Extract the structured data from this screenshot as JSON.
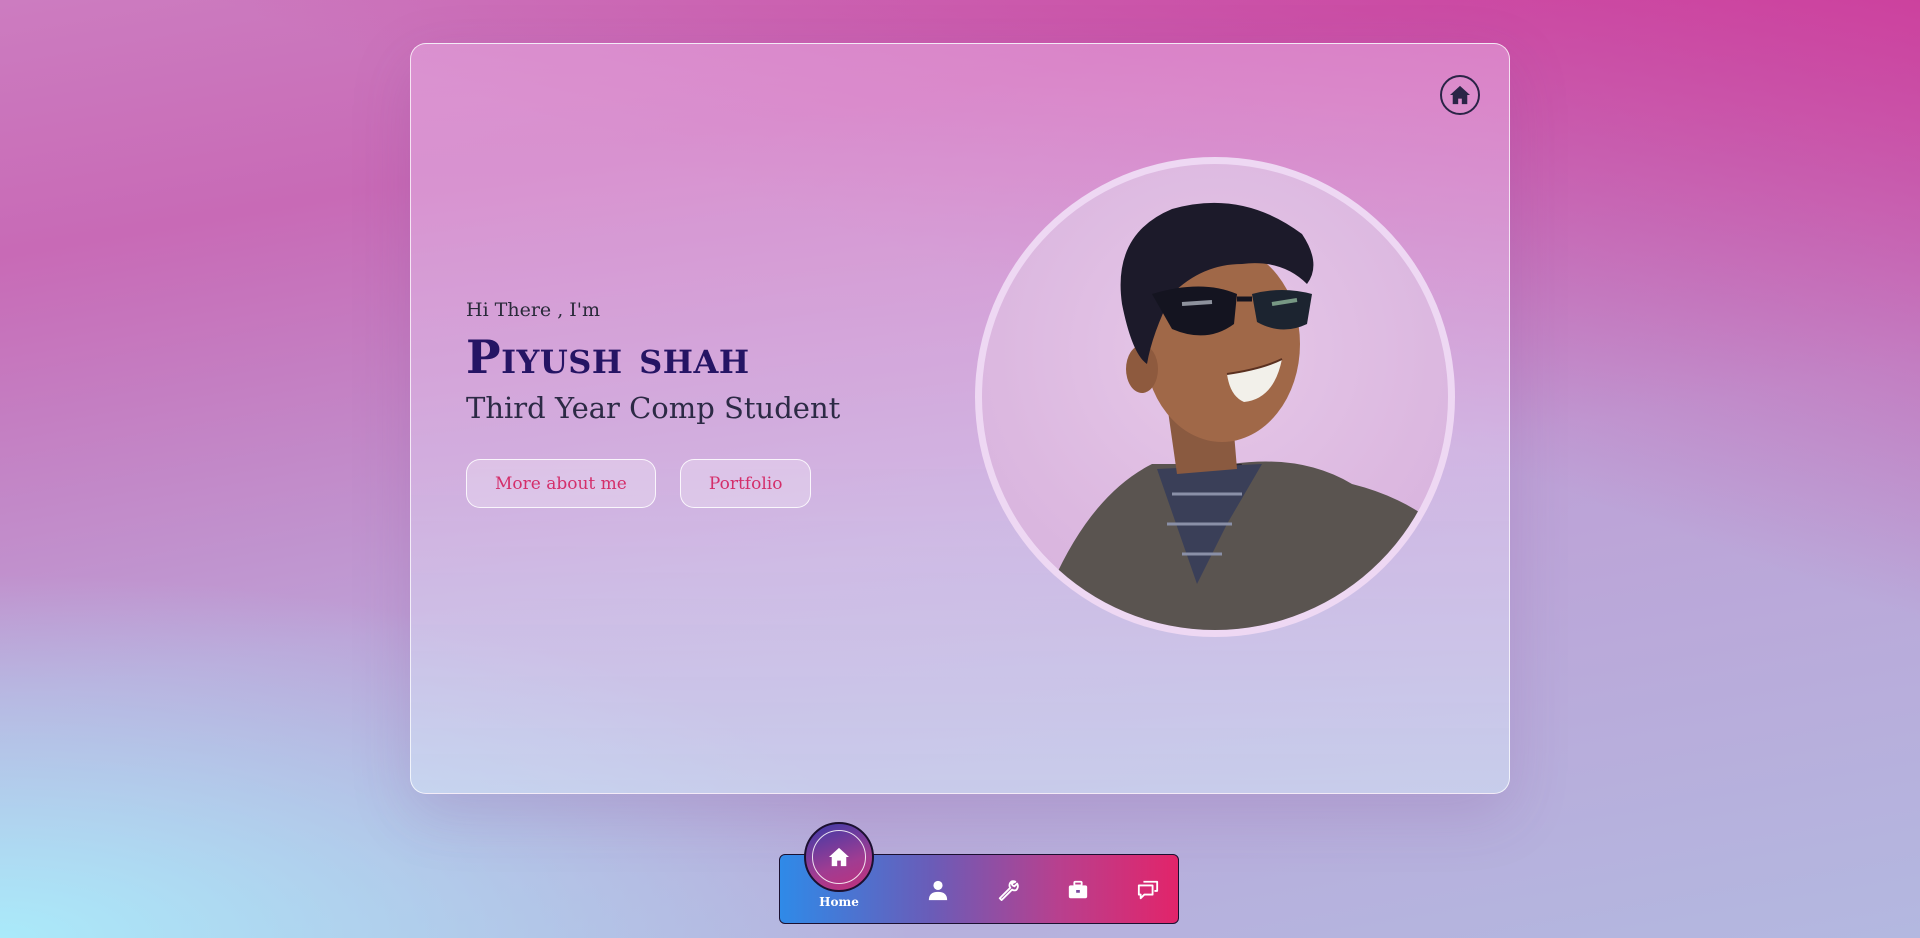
{
  "hero": {
    "greeting": "Hi There , I'm",
    "name": "Piyush shah",
    "role": "Third Year Comp Student",
    "buttons": {
      "about": "More about me",
      "portfolio": "Portfolio"
    },
    "photo_alt": "Profile photo"
  },
  "nav": {
    "items": [
      {
        "label": "Home",
        "icon": "home-icon",
        "active": true
      },
      {
        "label": "",
        "icon": "user-icon"
      },
      {
        "label": "",
        "icon": "wrench-icon"
      },
      {
        "label": "",
        "icon": "briefcase-icon"
      },
      {
        "label": "",
        "icon": "chat-icon"
      }
    ]
  },
  "colors": {
    "name": "#251464",
    "button_text": "#d42e6a",
    "nav_start": "#2f8ae8",
    "nav_end": "#e2246a"
  }
}
